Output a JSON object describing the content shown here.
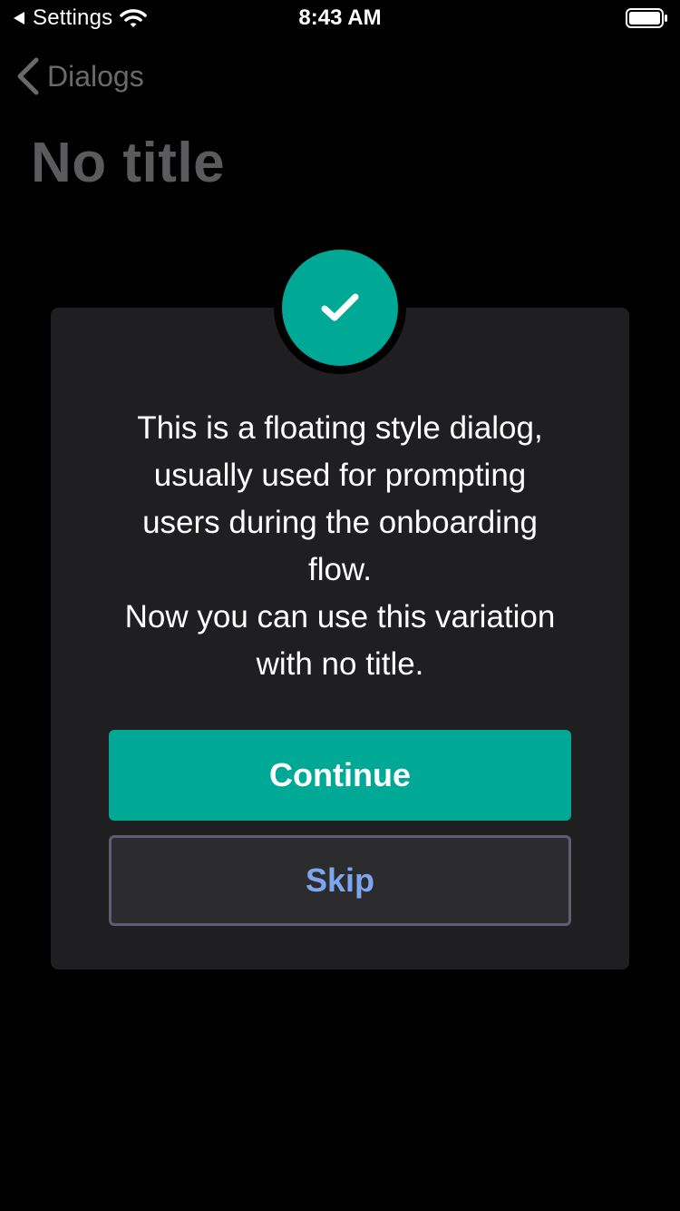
{
  "status_bar": {
    "back_app": "Settings",
    "time": "8:43 AM"
  },
  "nav": {
    "back_label": "Dialogs"
  },
  "page": {
    "title": "No title"
  },
  "dialog": {
    "message": "This is a floating style dialog,\nusually used for prompting\nusers during the onboarding\nflow.\nNow you can use this variation\nwith no title.",
    "primary_label": "Continue",
    "secondary_label": "Skip"
  },
  "colors": {
    "accent": "#00a896",
    "skip_text": "#7da6ee",
    "dialog_bg": "#1f1f21"
  },
  "icons": {
    "status_back": "triangle-left-icon",
    "wifi": "wifi-icon",
    "battery": "battery-icon",
    "nav_back": "chevron-left-icon",
    "badge": "checkmark-icon"
  }
}
